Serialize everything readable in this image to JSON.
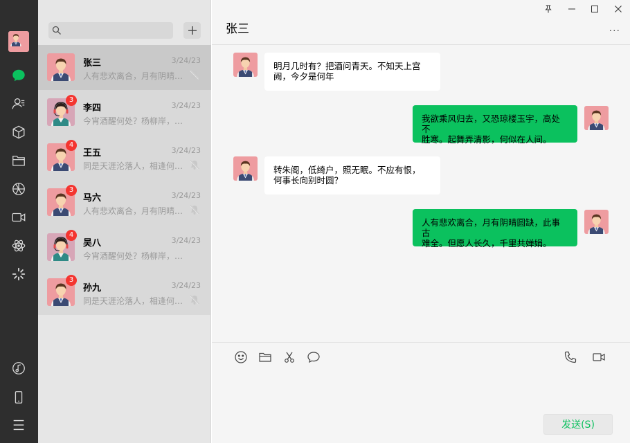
{
  "colors": {
    "iconbar_bg": "#2e2e2e",
    "list_bg": "#e6e6e6",
    "chat_bg": "#f5f5f5",
    "accent_green": "#0bc15e",
    "badge_red": "#f43530"
  },
  "sidebar": {
    "icons": [
      "user-avatar",
      "chat-icon",
      "contacts-icon",
      "box-icon",
      "folder-icon",
      "moments-icon",
      "video-icon",
      "atom-icon",
      "loading-icon",
      "music-icon",
      "phone-icon",
      "menu-icon"
    ]
  },
  "search": {
    "placeholder": "",
    "add_label": "+"
  },
  "conversations": [
    {
      "name": "张三",
      "time": "3/24/23",
      "preview": "人有悲欢离合，月有阴晴…",
      "badge": "",
      "avatar": "male",
      "muted": true,
      "active": true
    },
    {
      "name": "李四",
      "time": "3/24/23",
      "preview": "今宵酒醒何处？杨柳岸，…",
      "badge": "3",
      "avatar": "headset",
      "muted": false,
      "active": false
    },
    {
      "name": "王五",
      "time": "3/24/23",
      "preview": "同是天涯沦落人，相逢何…",
      "badge": "4",
      "avatar": "male",
      "muted": true,
      "active": false
    },
    {
      "name": "马六",
      "time": "3/24/23",
      "preview": "人有悲欢离合，月有阴晴…",
      "badge": "3",
      "avatar": "male",
      "muted": true,
      "active": false
    },
    {
      "name": "吴八",
      "time": "3/24/23",
      "preview": "今宵酒醒何处？杨柳岸，…",
      "badge": "4",
      "avatar": "headset",
      "muted": false,
      "active": false
    },
    {
      "name": "孙九",
      "time": "3/24/23",
      "preview": "同是天涯沦落人，相逢何…",
      "badge": "3",
      "avatar": "male",
      "muted": true,
      "active": false
    }
  ],
  "chat": {
    "title": "张三",
    "more_label": "...",
    "messages": [
      {
        "direction": "in",
        "lines": [
          "明月几时有？把酒问青天。不知天上宫",
          "阙，今夕是何年"
        ]
      },
      {
        "direction": "out",
        "lines": [
          "我欲乘风归去，又恐琼楼玉宇，高处不",
          "胜寒。起舞弄清影，何似在人间。"
        ]
      },
      {
        "direction": "in",
        "lines": [
          "转朱阁，低绮户，照无眠。不应有恨，",
          "何事长向别时圆？"
        ]
      },
      {
        "direction": "out",
        "lines": [
          "人有悲欢离合，月有阴晴圆缺，此事古",
          "难全。但愿人长久，千里共婵娟。"
        ]
      }
    ],
    "composer": {
      "tools": [
        "emoji-icon",
        "folder-icon",
        "scissors-icon",
        "chat-bubble-icon",
        "phone-call-icon",
        "video-call-icon"
      ],
      "send_label": "发送(S)"
    }
  },
  "window_controls": [
    "pin-icon",
    "minimize-icon",
    "maximize-icon",
    "close-icon"
  ]
}
